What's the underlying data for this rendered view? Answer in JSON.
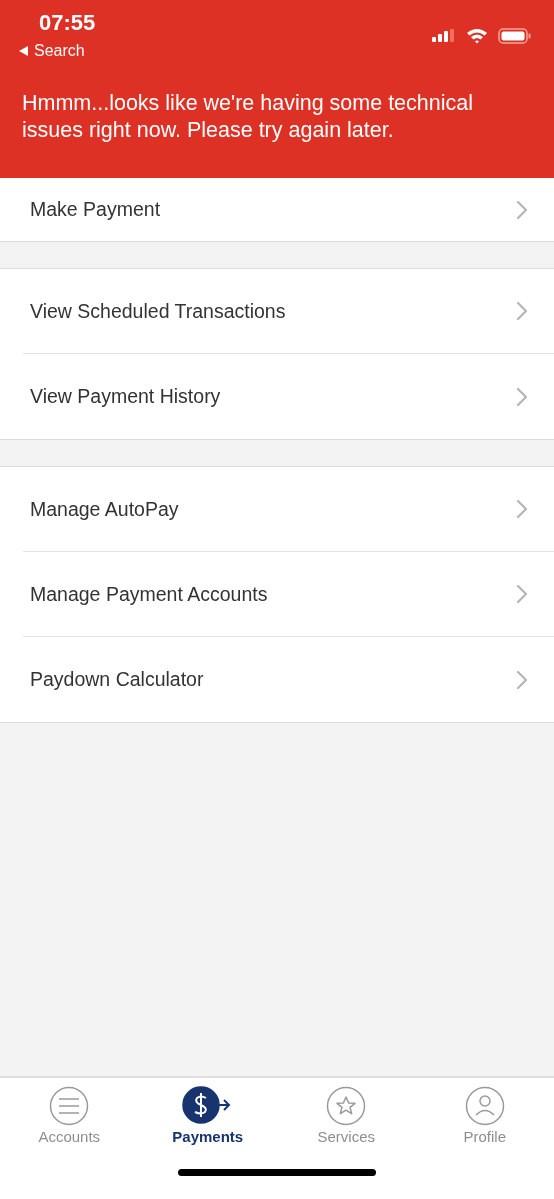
{
  "status_bar": {
    "time": "07:55",
    "back_label": "Search"
  },
  "error_banner": {
    "message": "Hmmm...looks like we're having some technical issues right now. Please try again later."
  },
  "groups": [
    {
      "items": [
        {
          "label": "Make Payment"
        }
      ]
    },
    {
      "items": [
        {
          "label": "View Scheduled Transactions"
        },
        {
          "label": "View Payment History"
        }
      ]
    },
    {
      "items": [
        {
          "label": "Manage AutoPay"
        },
        {
          "label": "Manage Payment Accounts"
        },
        {
          "label": "Paydown Calculator"
        }
      ]
    }
  ],
  "tab_bar": {
    "tabs": [
      {
        "label": "Accounts",
        "selected": false
      },
      {
        "label": "Payments",
        "selected": true
      },
      {
        "label": "Services",
        "selected": false
      },
      {
        "label": "Profile",
        "selected": false
      }
    ]
  }
}
